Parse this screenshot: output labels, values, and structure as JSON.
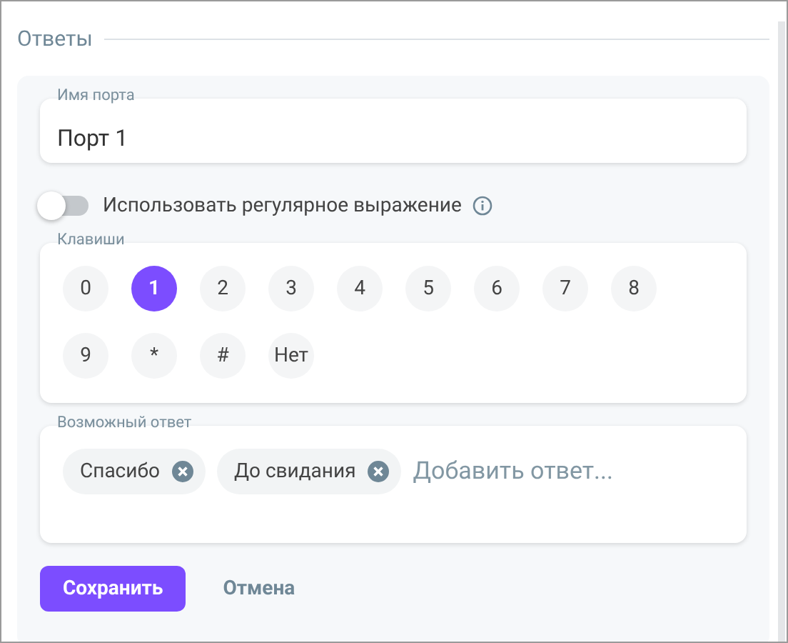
{
  "section_title": "Ответы",
  "port_name": {
    "label": "Имя порта",
    "value": "Порт 1"
  },
  "regex_toggle": {
    "label": "Использовать регулярное выражение",
    "on": false
  },
  "keys": {
    "label": "Клавиши",
    "items": [
      {
        "label": "0",
        "selected": false
      },
      {
        "label": "1",
        "selected": true
      },
      {
        "label": "2",
        "selected": false
      },
      {
        "label": "3",
        "selected": false
      },
      {
        "label": "4",
        "selected": false
      },
      {
        "label": "5",
        "selected": false
      },
      {
        "label": "6",
        "selected": false
      },
      {
        "label": "7",
        "selected": false
      },
      {
        "label": "8",
        "selected": false
      },
      {
        "label": "9",
        "selected": false
      },
      {
        "label": "*",
        "selected": false
      },
      {
        "label": "#",
        "selected": false
      },
      {
        "label": "Нет",
        "selected": false
      }
    ]
  },
  "answers": {
    "label": "Возможный ответ",
    "chips": [
      "Спасибо",
      "До свидания"
    ],
    "placeholder": "Добавить ответ..."
  },
  "buttons": {
    "save": "Сохранить",
    "cancel": "Отмена"
  }
}
